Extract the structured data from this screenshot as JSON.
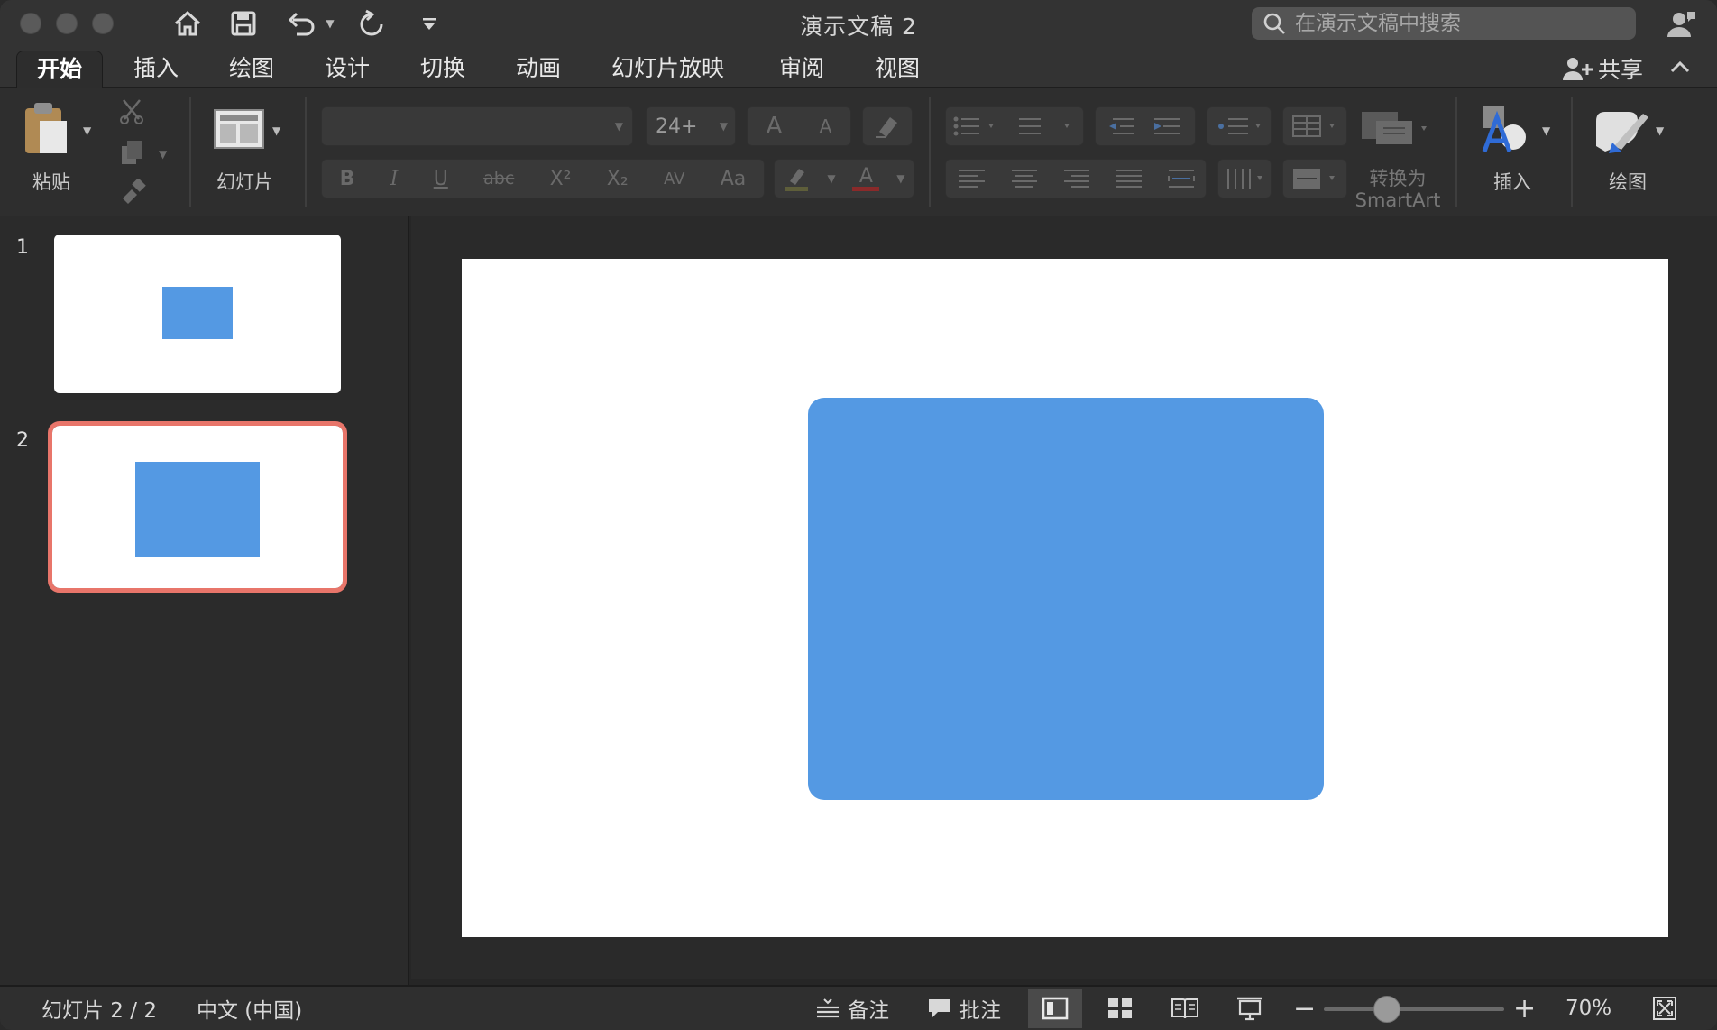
{
  "window": {
    "title": "演示文稿 2"
  },
  "search": {
    "placeholder": "在演示文稿中搜索"
  },
  "tabs": [
    {
      "label": "开始",
      "active": true
    },
    {
      "label": "插入"
    },
    {
      "label": "绘图"
    },
    {
      "label": "设计"
    },
    {
      "label": "切换"
    },
    {
      "label": "动画"
    },
    {
      "label": "幻灯片放映"
    },
    {
      "label": "审阅"
    },
    {
      "label": "视图"
    }
  ],
  "share": {
    "label": "共享"
  },
  "ribbon": {
    "paste_label": "粘贴",
    "slide_label": "幻灯片",
    "font_size_value": "24+",
    "smartart_line1": "转换为",
    "smartart_line2": "SmartArt",
    "insert_label": "插入",
    "draw_label": "绘图",
    "bold": "B",
    "italic": "I",
    "underline": "U",
    "strike": "abc",
    "superscript": "X²",
    "subscript": "X₂",
    "spacing": "AV",
    "change_case": "Aa",
    "font_color": "A",
    "grow_font": "A",
    "shrink_font": "A"
  },
  "thumbnails": [
    {
      "number": "1",
      "selected": false
    },
    {
      "number": "2",
      "selected": true
    }
  ],
  "statusbar": {
    "slide_info": "幻灯片 2 / 2",
    "language": "中文 (中国)",
    "notes_label": "备注",
    "comments_label": "批注",
    "zoom_label": "70%",
    "zoom_level": 0.35
  },
  "colors": {
    "shape_fill": "#5499e3",
    "selection_outline": "#e8756a"
  }
}
